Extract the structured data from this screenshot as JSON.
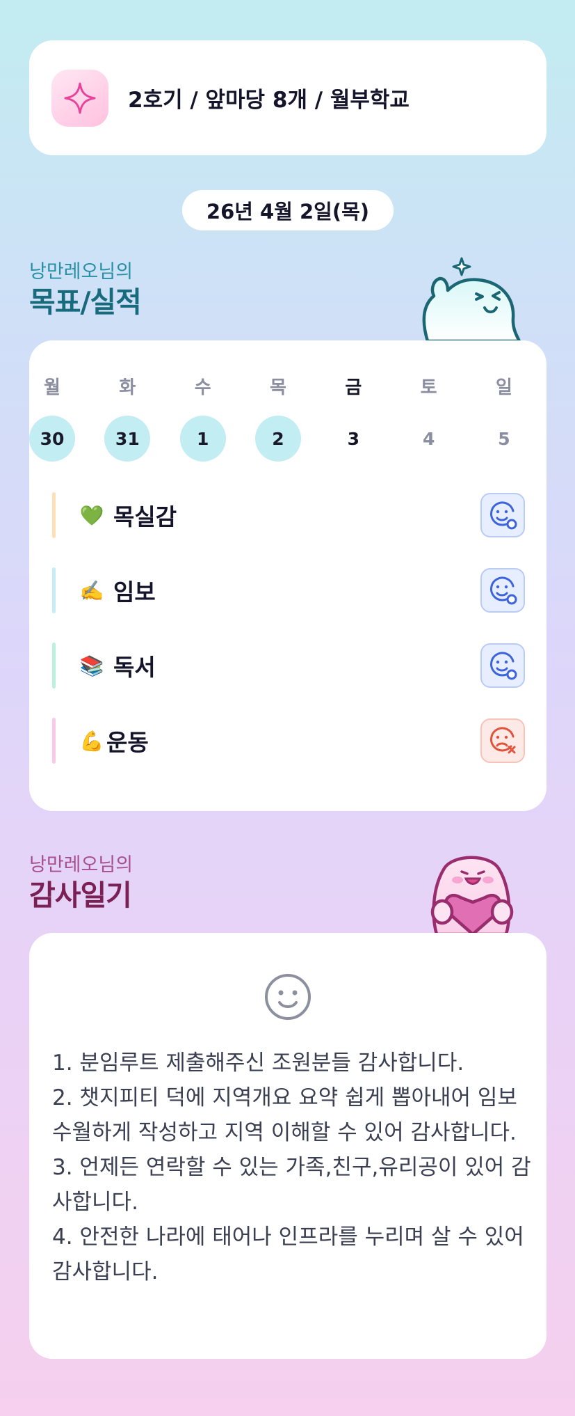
{
  "header": {
    "title": "2호기 / 앞마당 8개 / 월부학교",
    "icon": "sparkle-icon"
  },
  "date": "26년 4월 2일(목)",
  "goals_section": {
    "subtitle": "낭만레오님의",
    "title": "목표/실적",
    "weekdays": [
      "월",
      "화",
      "수",
      "목",
      "금",
      "토",
      "일"
    ],
    "days": [
      {
        "num": "30",
        "state": "done"
      },
      {
        "num": "31",
        "state": "done"
      },
      {
        "num": "1",
        "state": "done"
      },
      {
        "num": "2",
        "state": "done"
      },
      {
        "num": "3",
        "state": "today"
      },
      {
        "num": "4",
        "state": "future"
      },
      {
        "num": "5",
        "state": "future"
      }
    ],
    "goals": [
      {
        "emoji": "💚",
        "label": "목실감",
        "bar_color": "#fde0b8",
        "status": "achieved"
      },
      {
        "emoji": "✍️",
        "label": "임보",
        "bar_color": "#c4eef3",
        "status": "achieved"
      },
      {
        "emoji": "📚",
        "label": "독서",
        "bar_color": "#bdf0df",
        "status": "achieved"
      },
      {
        "emoji": "💪",
        "label": "운동",
        "bar_color": "#fbc9e8",
        "status": "not-achieved"
      }
    ]
  },
  "gratitude_section": {
    "subtitle": "낭만레오님의",
    "title": "감사일기",
    "mood_icon": "smile-face-icon",
    "text": "1. 분임루트 제출해주신 조원분들 감사합니다.\n2. 챗지피티 덕에 지역개요 요약 쉽게 뽑아내어 임보 수월하게 작성하고 지역 이해할 수 있어 감사합니다.\n3. 언제든 연락할 수 있는 가족,친구,유리공이 있어 감사합니다.\n4. 안전한 나라에 태어나 인프라를 누리며 살 수 있어 감사합니다."
  },
  "colors": {
    "accent_teal": "#176b7c",
    "accent_plum": "#7a2055",
    "done_day": "#c2edf3",
    "status_good": "#3d63dd",
    "status_bad": "#e0533d"
  }
}
